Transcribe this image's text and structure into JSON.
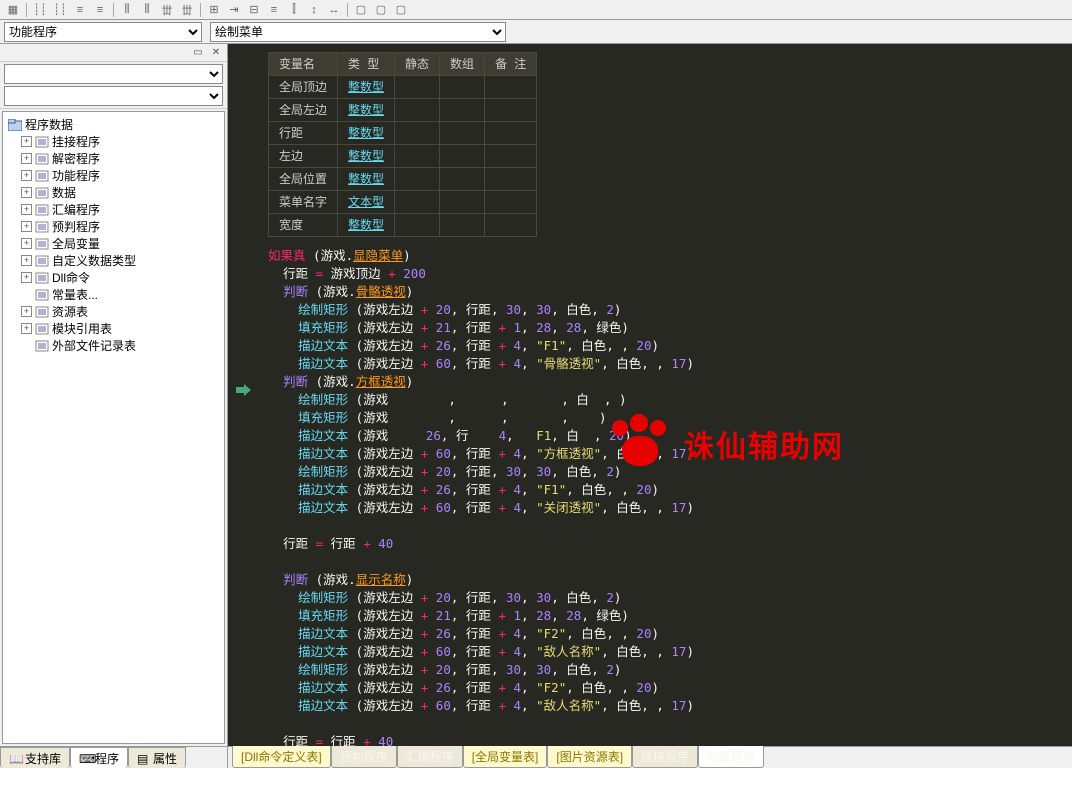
{
  "dropdowns": {
    "d1": "功能程序",
    "d2": "绘制菜单"
  },
  "tree": {
    "root": "程序数据",
    "items": [
      {
        "label": "挂接程序",
        "exp": true
      },
      {
        "label": "解密程序",
        "exp": true
      },
      {
        "label": "功能程序",
        "exp": true
      },
      {
        "label": "数据",
        "exp": true
      },
      {
        "label": "汇编程序",
        "exp": true
      },
      {
        "label": "预判程序",
        "exp": true
      },
      {
        "label": "全局变量",
        "exp": true
      },
      {
        "label": "自定义数据类型",
        "exp": true
      },
      {
        "label": "Dll命令",
        "exp": true
      },
      {
        "label": "常量表...",
        "exp": false
      },
      {
        "label": "资源表",
        "exp": true
      },
      {
        "label": "模块引用表",
        "exp": true
      },
      {
        "label": "外部文件记录表",
        "exp": false
      }
    ]
  },
  "left_tabs": [
    "支持库",
    "程序",
    "属性"
  ],
  "var_table": {
    "headers": [
      "变量名",
      "类 型",
      "静态",
      "数组",
      "备 注"
    ],
    "rows": [
      {
        "name": "全局顶边",
        "type": "整数型"
      },
      {
        "name": "全局左边",
        "type": "整数型"
      },
      {
        "name": "行距",
        "type": "整数型"
      },
      {
        "name": "左边",
        "type": "整数型"
      },
      {
        "name": "全局位置",
        "type": "整数型"
      },
      {
        "name": "菜单名字",
        "type": "文本型"
      },
      {
        "name": "宽度",
        "type": "整数型"
      }
    ]
  },
  "code": {
    "kw_if": "如果真",
    "kw_judge": "判断",
    "game": "游戏",
    "menu_var": "显隐菜单",
    "line_spacing": "行距",
    "game_top": "游戏顶边",
    "game_left": "游戏左边",
    "draw_rect": "绘制矩形",
    "fill_rect": "填充矩形",
    "outline_text": "描边文本",
    "white": "白色",
    "green": "绿色",
    "bone_esp": "骨骼透视",
    "box_esp": "方框透视",
    "close_esp": "关闭透视",
    "show_name": "显示名称",
    "enemy_name": "敌人名称",
    "str_f1": "\"F1\"",
    "str_f2": "\"F2\"",
    "str_bone": "\"骨骼透视\"",
    "str_box": "\"方框透视\"",
    "str_close": "\"关闭透视\"",
    "str_enemy": "\"敌人名称\""
  },
  "bottom_tabs": [
    {
      "label": "[Dll命令定义表]",
      "yellow": true
    },
    {
      "label": "预判程序"
    },
    {
      "label": "汇编程序"
    },
    {
      "label": "[全局变量表]",
      "yellow": true
    },
    {
      "label": "[图片资源表]",
      "yellow": true
    },
    {
      "label": "挂接程序"
    },
    {
      "label": "功能程序",
      "active": true
    }
  ],
  "watermark": "诛仙辅助网"
}
